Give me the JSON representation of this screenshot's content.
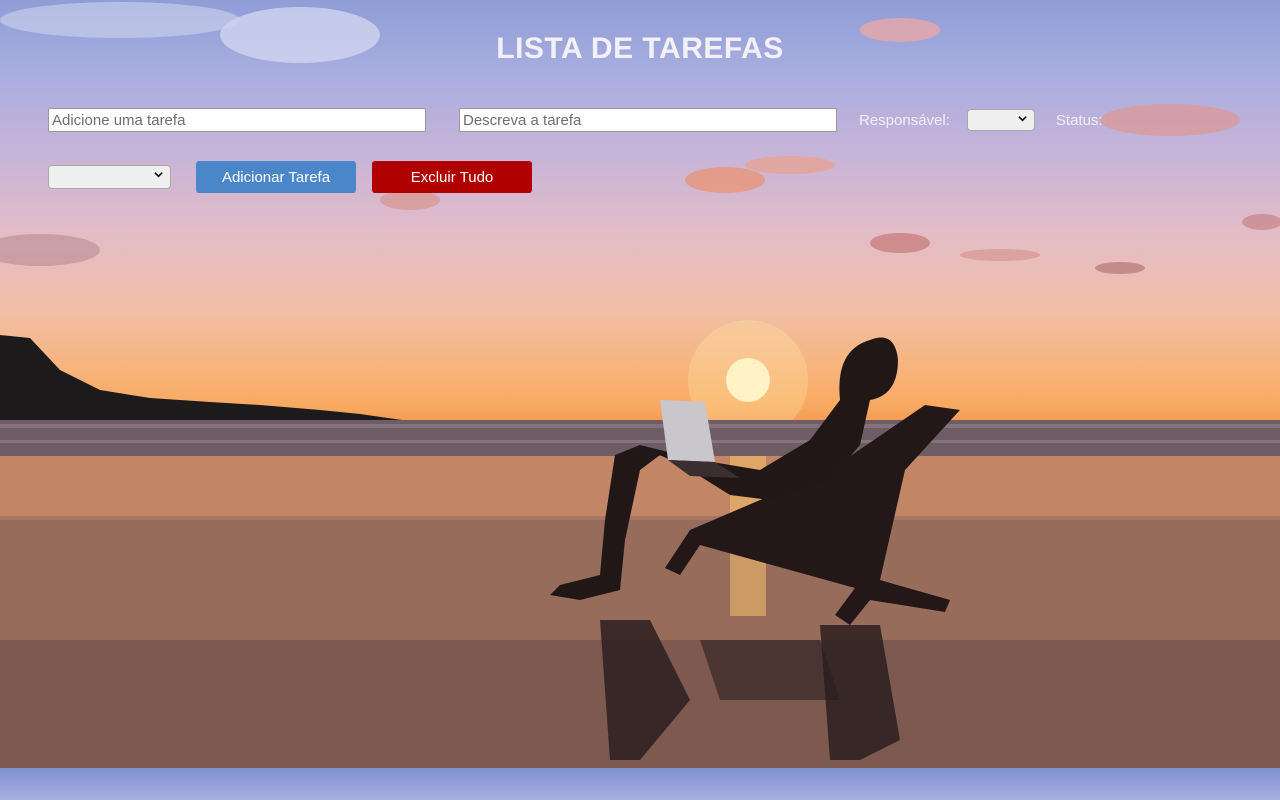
{
  "page": {
    "title": "LISTA DE TAREFAS"
  },
  "form": {
    "task_input": {
      "placeholder": "Adicione uma tarefa",
      "value": ""
    },
    "description_input": {
      "placeholder": "Descreva a tarefa",
      "value": ""
    },
    "responsible": {
      "label": "Responsável:",
      "selected": ""
    },
    "status": {
      "label": "Status:",
      "selected": ""
    },
    "add_button_label": "Adicionar Tarefa",
    "delete_all_button_label": "Excluir Tudo"
  },
  "colors": {
    "add_button": "#4a86c8",
    "delete_button": "#b00000",
    "title_text": "#f3f1f6"
  },
  "icons": {
    "select_arrow": "chevron-down-icon"
  }
}
